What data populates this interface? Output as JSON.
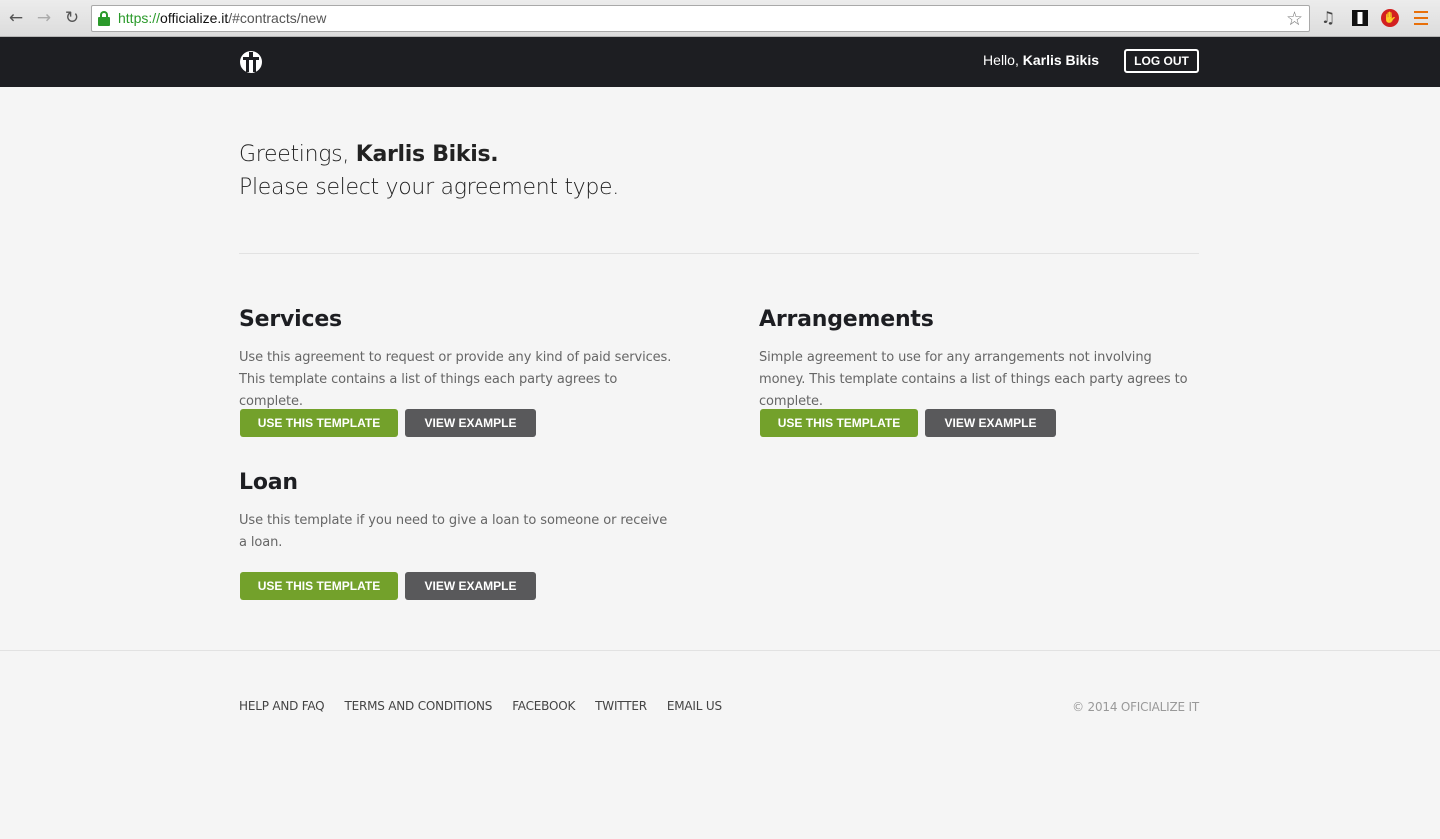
{
  "browser": {
    "url_scheme": "https://",
    "url_host": "officialize.it",
    "url_path": "/#contracts/new"
  },
  "header": {
    "hello_prefix": "Hello, ",
    "user_name": "Karlis Bikis",
    "logout_label": "LOG OUT"
  },
  "intro": {
    "greeting_prefix": "Greetings, ",
    "greeting_name": "Karlis Bikis.",
    "subtitle": "Please select your agreement type."
  },
  "templates": [
    {
      "title": "Services",
      "description": "Use this agreement to request or provide any kind of paid services. This template contains a list of things each party agrees to complete.",
      "use_label": "USE THIS TEMPLATE",
      "view_label": "VIEW EXAMPLE"
    },
    {
      "title": "Arrangements",
      "description": "Simple agreement to use for any arrangements not involving money. This template contains a list of things each party agrees to complete.",
      "use_label": "USE THIS TEMPLATE",
      "view_label": "VIEW EXAMPLE"
    },
    {
      "title": "Loan",
      "description": "Use this template if you need to give a loan to someone or receive a loan.",
      "use_label": "USE THIS TEMPLATE",
      "view_label": "VIEW EXAMPLE"
    }
  ],
  "footer": {
    "links": [
      "HELP AND FAQ",
      "TERMS AND CONDITIONS",
      "FACEBOOK",
      "TWITTER",
      "EMAIL US"
    ],
    "copyright": "© 2014 OFICIALIZE IT"
  },
  "colors": {
    "header_bg": "#1d1e22",
    "primary_button": "#73a12b",
    "secondary_button": "#59595b",
    "page_bg": "#f5f5f5"
  },
  "icons": {
    "back": "arrow-left-icon",
    "forward": "arrow-right-icon",
    "reload": "reload-icon",
    "secure": "lock-icon",
    "bookmark": "star-icon",
    "logo": "officialize-logo"
  }
}
